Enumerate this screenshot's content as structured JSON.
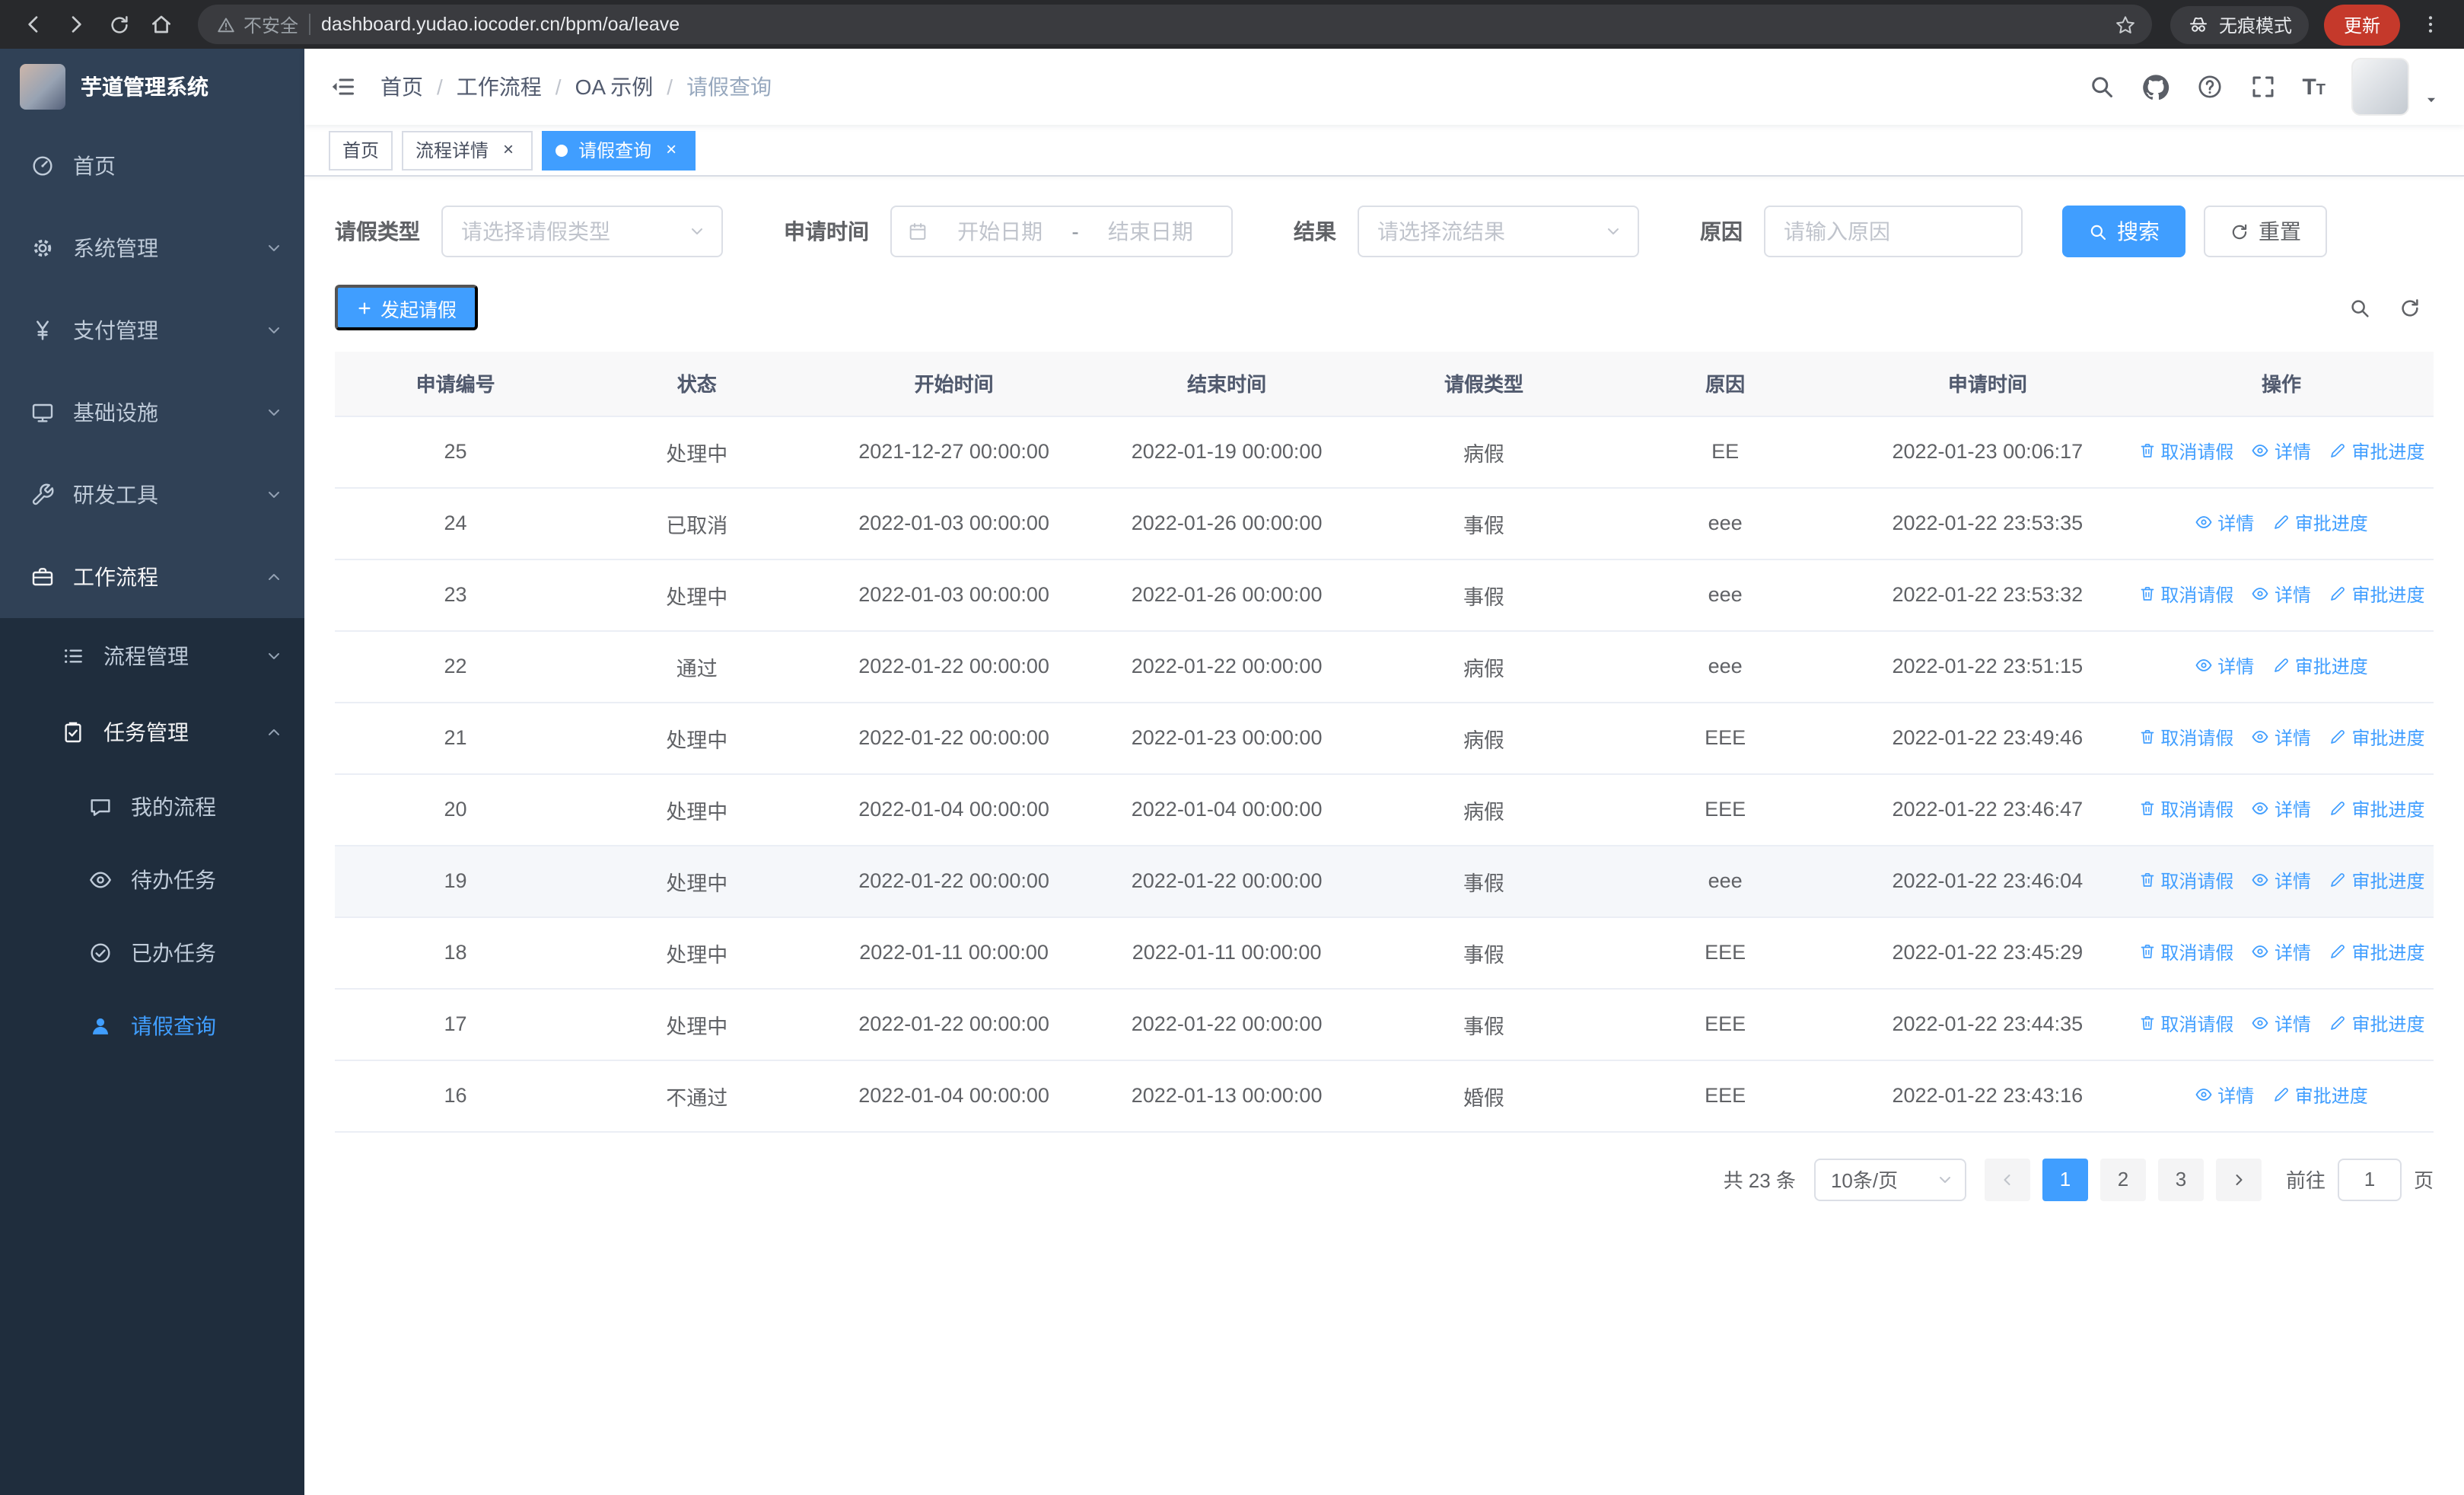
{
  "browser": {
    "security_label": "不安全",
    "url": "dashboard.yudao.iocoder.cn/bpm/oa/leave",
    "incognito_label": "无痕模式",
    "update_label": "更新"
  },
  "sidebar": {
    "logo_title": "芋道管理系统",
    "items": [
      {
        "label": "首页",
        "icon": "dashboard-icon",
        "level": 1
      },
      {
        "label": "系统管理",
        "icon": "gear-icon",
        "level": 1,
        "expandable": true
      },
      {
        "label": "支付管理",
        "icon": "yen-icon",
        "level": 1,
        "expandable": true
      },
      {
        "label": "基础设施",
        "icon": "monitor-icon",
        "level": 1,
        "expandable": true
      },
      {
        "label": "研发工具",
        "icon": "wrench-icon",
        "level": 1,
        "expandable": true
      },
      {
        "label": "工作流程",
        "icon": "briefcase-icon",
        "level": 1,
        "expanded": true
      },
      {
        "label": "流程管理",
        "icon": "list-icon",
        "level": 2,
        "expandable": true
      },
      {
        "label": "任务管理",
        "icon": "clipboard-icon",
        "level": 2,
        "expanded": true
      },
      {
        "label": "我的流程",
        "icon": "chat-icon",
        "level": 3
      },
      {
        "label": "待办任务",
        "icon": "eye-icon",
        "level": 3
      },
      {
        "label": "已办任务",
        "icon": "check-circle-icon",
        "level": 3
      },
      {
        "label": "请假查询",
        "icon": "user-icon",
        "level": 3,
        "active": true
      }
    ]
  },
  "navbar": {
    "breadcrumb": {
      "separator": "/",
      "items": [
        "首页",
        "工作流程",
        "OA 示例",
        "请假查询"
      ]
    }
  },
  "tags": {
    "items": [
      {
        "label": "首页",
        "closable": false,
        "active": false
      },
      {
        "label": "流程详情",
        "closable": true,
        "active": false
      },
      {
        "label": "请假查询",
        "closable": true,
        "active": true
      }
    ]
  },
  "filters": {
    "leave_type_label": "请假类型",
    "leave_type_placeholder": "请选择请假类型",
    "apply_time_label": "申请时间",
    "start_date_placeholder": "开始日期",
    "range_separator": "-",
    "end_date_placeholder": "结束日期",
    "result_label": "结果",
    "result_placeholder": "请选择流结果",
    "reason_label": "原因",
    "reason_placeholder": "请输入原因",
    "search_button": "搜索",
    "reset_button": "重置"
  },
  "toolbar": {
    "create_button": "发起请假"
  },
  "table": {
    "headers": [
      "申请编号",
      "状态",
      "开始时间",
      "结束时间",
      "请假类型",
      "原因",
      "申请时间",
      "操作"
    ],
    "actions": {
      "cancel": "取消请假",
      "detail": "详情",
      "progress": "审批进度"
    },
    "rows": [
      {
        "id": "25",
        "status": "处理中",
        "start": "2021-12-27 00:00:00",
        "end": "2022-01-19 00:00:00",
        "type": "病假",
        "reason": "EE",
        "applied": "2022-01-23 00:06:17",
        "can_cancel": true
      },
      {
        "id": "24",
        "status": "已取消",
        "start": "2022-01-03 00:00:00",
        "end": "2022-01-26 00:00:00",
        "type": "事假",
        "reason": "eee",
        "applied": "2022-01-22 23:53:35",
        "can_cancel": false
      },
      {
        "id": "23",
        "status": "处理中",
        "start": "2022-01-03 00:00:00",
        "end": "2022-01-26 00:00:00",
        "type": "事假",
        "reason": "eee",
        "applied": "2022-01-22 23:53:32",
        "can_cancel": true
      },
      {
        "id": "22",
        "status": "通过",
        "start": "2022-01-22 00:00:00",
        "end": "2022-01-22 00:00:00",
        "type": "病假",
        "reason": "eee",
        "applied": "2022-01-22 23:51:15",
        "can_cancel": false
      },
      {
        "id": "21",
        "status": "处理中",
        "start": "2022-01-22 00:00:00",
        "end": "2022-01-23 00:00:00",
        "type": "病假",
        "reason": "EEE",
        "applied": "2022-01-22 23:49:46",
        "can_cancel": true
      },
      {
        "id": "20",
        "status": "处理中",
        "start": "2022-01-04 00:00:00",
        "end": "2022-01-04 00:00:00",
        "type": "病假",
        "reason": "EEE",
        "applied": "2022-01-22 23:46:47",
        "can_cancel": true
      },
      {
        "id": "19",
        "status": "处理中",
        "start": "2022-01-22 00:00:00",
        "end": "2022-01-22 00:00:00",
        "type": "事假",
        "reason": "eee",
        "applied": "2022-01-22 23:46:04",
        "can_cancel": true
      },
      {
        "id": "18",
        "status": "处理中",
        "start": "2022-01-11 00:00:00",
        "end": "2022-01-11 00:00:00",
        "type": "事假",
        "reason": "EEE",
        "applied": "2022-01-22 23:45:29",
        "can_cancel": true
      },
      {
        "id": "17",
        "status": "处理中",
        "start": "2022-01-22 00:00:00",
        "end": "2022-01-22 00:00:00",
        "type": "事假",
        "reason": "EEE",
        "applied": "2022-01-22 23:44:35",
        "can_cancel": true
      },
      {
        "id": "16",
        "status": "不通过",
        "start": "2022-01-04 00:00:00",
        "end": "2022-01-13 00:00:00",
        "type": "婚假",
        "reason": "EEE",
        "applied": "2022-01-22 23:43:16",
        "can_cancel": false
      }
    ]
  },
  "pagination": {
    "total_label": "共 23 条",
    "page_size": "10条/页",
    "pages": [
      "1",
      "2",
      "3"
    ],
    "active_page": "1",
    "goto_label": "前往",
    "goto_value": "1",
    "page_unit": "页"
  },
  "colors": {
    "primary": "#409eff",
    "sidebar_bg": "#304156",
    "sidebar_submenu_bg": "#1f2d3d",
    "update_chip_bg": "#c5392b",
    "table_header_bg": "#f8f8f9"
  },
  "icons": {
    "browser": [
      "back-icon",
      "forward-icon",
      "reload-icon",
      "home-icon",
      "warning-icon",
      "star-icon",
      "incognito-icon",
      "kebab-menu-icon"
    ],
    "navbar": [
      "hamburger-icon",
      "search-icon",
      "github-icon",
      "question-icon",
      "fullscreen-icon",
      "font-size-icon",
      "caret-down-icon"
    ],
    "filter": [
      "calendar-icon",
      "chevron-down-icon",
      "search-icon",
      "refresh-icon",
      "plus-icon"
    ],
    "table_actions": [
      "trash-icon",
      "eye-icon",
      "edit-icon"
    ]
  }
}
